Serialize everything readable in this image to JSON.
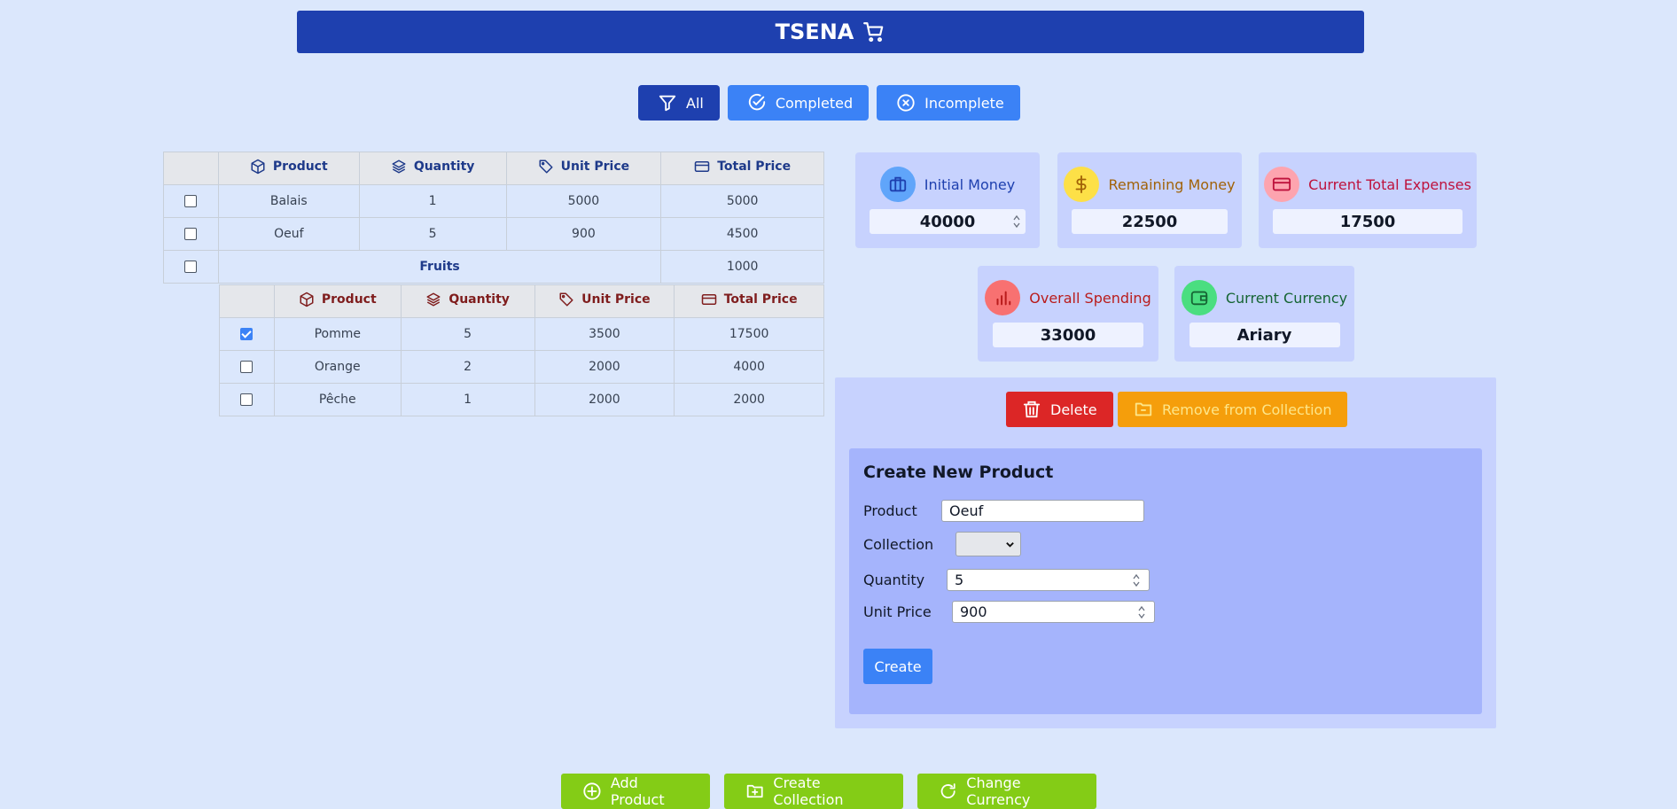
{
  "header": {
    "title": "TSENA",
    "icon": "shopping-cart-icon"
  },
  "filters": [
    {
      "label": "All",
      "icon": "filter-icon",
      "active": true
    },
    {
      "label": "Completed",
      "icon": "check-circle-icon",
      "active": false
    },
    {
      "label": "Incomplete",
      "icon": "x-circle-icon",
      "active": false
    }
  ],
  "table": {
    "columns": [
      "Product",
      "Quantity",
      "Unit Price",
      "Total Price"
    ],
    "rows": [
      {
        "checked": false,
        "product": "Balais",
        "quantity": "1",
        "unit_price": "5000",
        "total_price": "5000"
      },
      {
        "checked": false,
        "product": "Oeuf",
        "quantity": "5",
        "unit_price": "900",
        "total_price": "4500"
      }
    ],
    "collection": {
      "checked": false,
      "name": "Fruits",
      "total_price": "1000"
    }
  },
  "subtable": {
    "columns": [
      "Product",
      "Quantity",
      "Unit Price",
      "Total Price"
    ],
    "rows": [
      {
        "checked": true,
        "product": "Pomme",
        "quantity": "5",
        "unit_price": "3500",
        "total_price": "17500"
      },
      {
        "checked": false,
        "product": "Orange",
        "quantity": "2",
        "unit_price": "2000",
        "total_price": "4000"
      },
      {
        "checked": false,
        "product": "Pêche",
        "quantity": "1",
        "unit_price": "2000",
        "total_price": "2000"
      }
    ]
  },
  "stats": {
    "initial_money": {
      "label": "Initial Money",
      "value": "40000",
      "color": "#1e40af",
      "icon_bg": "#60a5fa"
    },
    "remaining_money": {
      "label": "Remaining Money",
      "value": "22500",
      "color": "#a16207",
      "icon_bg": "#fde047"
    },
    "current_total_expenses": {
      "label": "Current Total Expenses",
      "value": "17500",
      "color": "#be123c",
      "icon_bg": "#fda4af"
    },
    "overall_spending": {
      "label": "Overall Spending",
      "value": "33000",
      "color": "#b91c1c",
      "icon_bg": "#f87171"
    },
    "current_currency": {
      "label": "Current Currency",
      "value": "Ariary",
      "color": "#166534",
      "icon_bg": "#4ade80"
    }
  },
  "actions": {
    "delete_label": "Delete",
    "remove_label": "Remove from Collection"
  },
  "form": {
    "title": "Create New Product",
    "product_label": "Product",
    "product_value": "Oeuf",
    "collection_label": "Collection",
    "collection_value": "",
    "quantity_label": "Quantity",
    "quantity_value": "5",
    "unit_price_label": "Unit Price",
    "unit_price_value": "900",
    "create_label": "Create"
  },
  "bottom": {
    "add_product": "Add Product",
    "create_collection": "Create Collection",
    "change_currency": "Change Currency"
  }
}
